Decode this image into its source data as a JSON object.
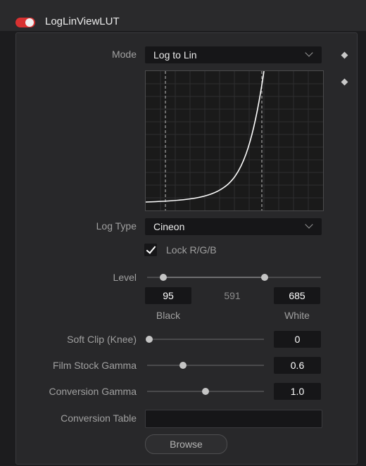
{
  "header": {
    "title": "LogLinViewLUT"
  },
  "mode": {
    "label": "Mode",
    "value": "Log to Lin"
  },
  "log_type": {
    "label": "Log Type",
    "value": "Cineon"
  },
  "lock": {
    "label": "Lock R/G/B",
    "checked": true
  },
  "level": {
    "label": "Level",
    "black_value": "95",
    "mid_value": "591",
    "white_value": "685",
    "black_label": "Black",
    "white_label": "White",
    "range": [
      0,
      1023
    ]
  },
  "soft_clip": {
    "label": "Soft Clip (Knee)",
    "value": "0",
    "fraction": 0.0
  },
  "film_stock_gamma": {
    "label": "Film Stock Gamma",
    "value": "0.6",
    "fraction": 0.3
  },
  "conversion_gamma": {
    "label": "Conversion Gamma",
    "value": "1.0",
    "fraction": 0.5
  },
  "conversion_table": {
    "label": "Conversion Table",
    "value": ""
  },
  "browse": {
    "label": "Browse"
  },
  "colors": {
    "accent": "#d83131",
    "panel": "#28282a",
    "field": "#161618"
  }
}
